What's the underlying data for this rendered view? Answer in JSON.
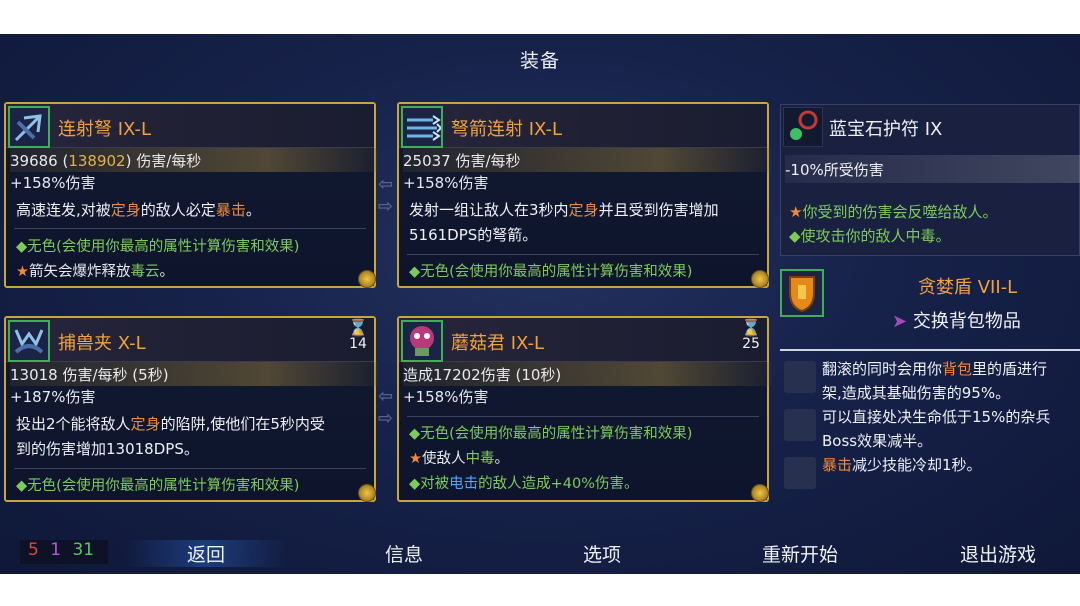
{
  "title": "装备",
  "weapons": [
    {
      "name": "连射弩 IX-L",
      "stat1_a": "39686 (",
      "stat1_b": "138902",
      "stat1_c": ") 伤害/每秒",
      "stat2": "+158%伤害",
      "desc_a": "高速连发,对被",
      "desc_b": "定身",
      "desc_c": "的敌人必定",
      "desc_d": "暴击",
      "desc_e": "。",
      "line1": "◆无色(会使用你最高的属性计算伤害和效果)",
      "line2_a": "箭矢会爆炸释放",
      "line2_b": "毒云",
      "line2_c": "。"
    },
    {
      "name": "弩箭连射 IX-L",
      "stat1": "25037 伤害/每秒",
      "stat2": "+158%伤害",
      "desc_a": "发射一组让敌人在3秒内",
      "desc_b": "定身",
      "desc_c": "并且受到伤害增加",
      "desc_d": "5161DPS的弩箭。",
      "line1": "◆无色(会使用你最高的属性计算伤害和效果)"
    },
    {
      "name": "捕兽夹 X-L",
      "cooldown": "14",
      "stat1": "13018 伤害/每秒 (5秒)",
      "stat2": "+187%伤害",
      "desc_a": "投出2个能将敌人",
      "desc_b": "定身",
      "desc_c": "的陷阱,使他们在5秒内受",
      "desc_d": "到的伤害增加13018DPS。",
      "line1": "◆无色(会使用你最高的属性计算伤害和效果)"
    },
    {
      "name": "蘑菇君 IX-L",
      "cooldown": "25",
      "stat1": "造成17202伤害 (10秒)",
      "stat2": "+158%伤害",
      "line1": "◆无色(会使用你最高的属性计算伤害和效果)",
      "line2_a": "使敌人",
      "line2_b": "中毒",
      "line2_c": "。",
      "line3_a": "◆对被",
      "line3_b": "电击",
      "line3_c": "的敌人造成+40%伤害。"
    }
  ],
  "amulet": {
    "name": "蓝宝石护符 IX",
    "stat": "-10%所受伤害",
    "line1": "你受到的伤害会反噬给敌人。",
    "line2_a": "◆使攻击你的敌人",
    "line2_b": "中毒",
    "line2_c": "。"
  },
  "shield": {
    "name": "贪婪盾 VII-L",
    "swap_label": "交换背包物品",
    "row1_a": "翻滚的同时会用你",
    "row1_b": "背包",
    "row1_c": "里的盾进行",
    "row1_d": "架,造成其基础伤害的95%。",
    "row2_a": "可以直接处决生命低于15%的杂兵",
    "row2_b": "Boss效果减半。",
    "row3_a": "暴击",
    "row3_b": "减少技能冷却1秒。"
  },
  "scrolls": {
    "red": "5",
    "purple": "1",
    "green": "31"
  },
  "menu": {
    "back": "返回",
    "info": "信息",
    "options": "选项",
    "restart": "重新开始",
    "quit": "退出游戏"
  },
  "colors": {
    "gold_border": "#c9a53c",
    "name_orange": "#f0a23c",
    "green_text": "#7ccb5c",
    "hl_orange": "#f08a3a",
    "hl_blue": "#4aa8ff"
  }
}
